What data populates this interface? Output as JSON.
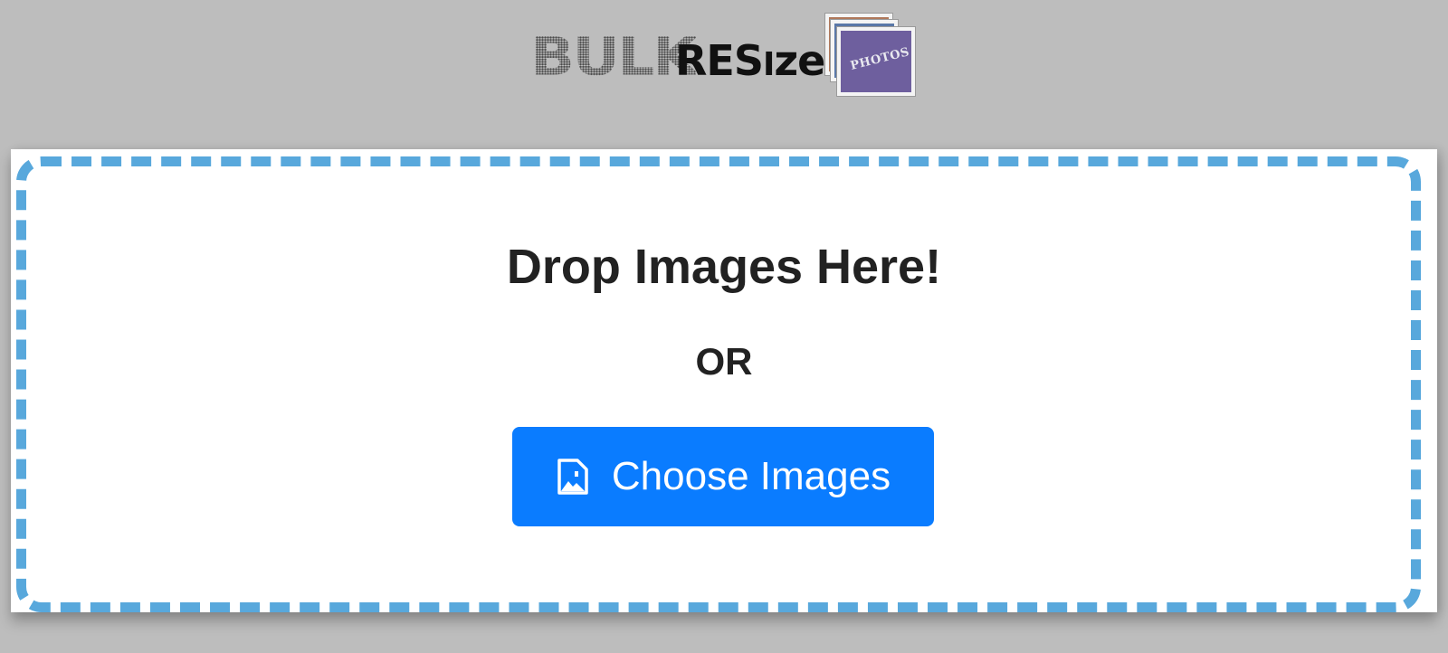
{
  "logo": {
    "bulk": "BULK",
    "resize_part1": "RES",
    "resize_part2": "I",
    "resize_part3": "ze",
    "photos": "PHOTOS",
    "photo_colors": [
      "#b0785a",
      "#5a78a8",
      "#6e5f9e"
    ]
  },
  "dropzone": {
    "title": "Drop Images Here!",
    "or": "OR",
    "border_color": "#58a8dc"
  },
  "choose_button": {
    "label": "Choose Images",
    "icon": "image-file-icon",
    "color": "#0a7cff"
  }
}
